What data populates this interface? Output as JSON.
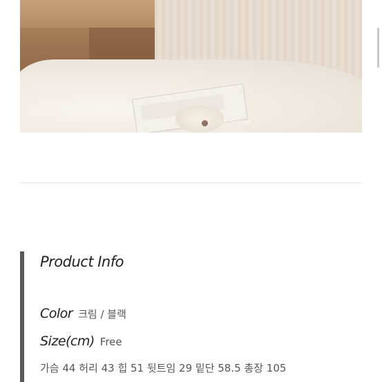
{
  "photo": {
    "watermark": "LA.Neutal"
  },
  "product_info": {
    "title": "Product Info",
    "color": {
      "label": "Color",
      "value": "크림 / 블랙"
    },
    "size": {
      "label": "Size(cm)",
      "value": "Free"
    },
    "measurements": "가슴 44 허리 43 힙 51 뒷트임 29 밑단 58.5 총장 105"
  },
  "colors": {
    "accent_bar": "#595959",
    "divider": "#e6e6e6",
    "label_text": "#222222",
    "value_text": "#555555"
  }
}
